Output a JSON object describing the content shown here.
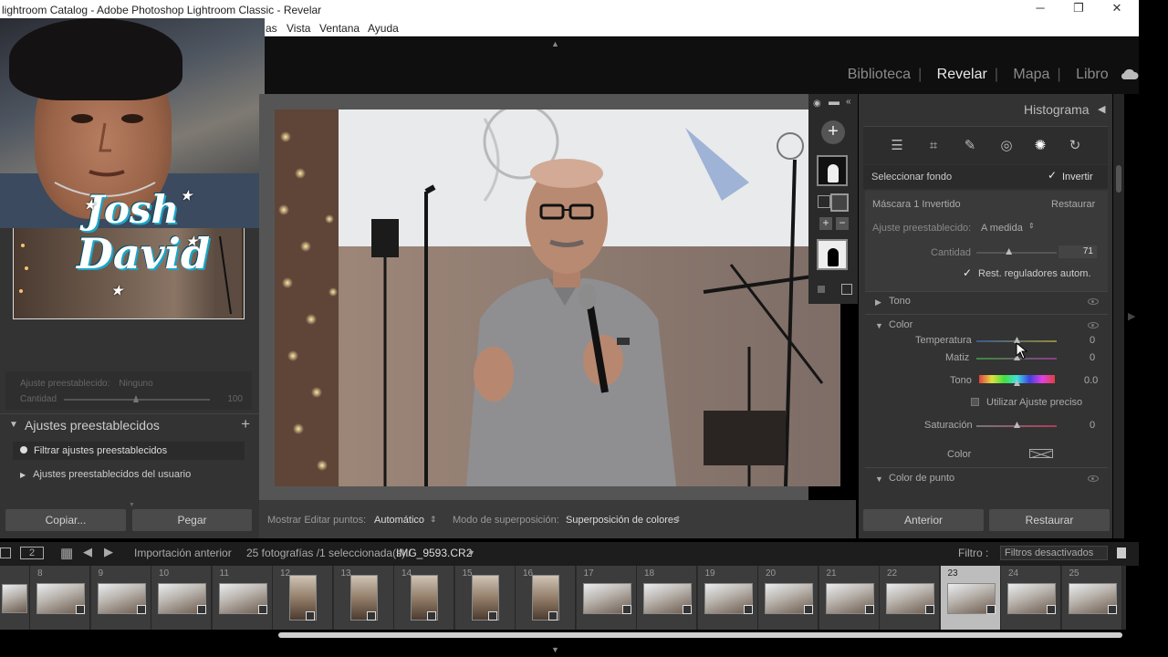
{
  "window": {
    "title": "lightroom Catalog - Adobe Photoshop Lightroom Classic - Revelar",
    "minimize": "─",
    "restore": "❐",
    "close": "✕"
  },
  "menu": [
    "as",
    "Vista",
    "Ventana",
    "Ayuda"
  ],
  "modules": [
    "Biblioteca",
    "Revelar",
    "Mapa",
    "Libro"
  ],
  "modules_more": "»",
  "overlay": {
    "logo_line1": "Josh",
    "logo_line2": "David"
  },
  "left": {
    "preset_label": "Ajuste preestablecido:",
    "preset_value": "Ninguno",
    "amount_label": "Cantidad",
    "amount_value": "100",
    "presets_title": "Ajustes preestablecidos",
    "add_symbol": "+",
    "filter_placeholder": "Filtrar ajustes preestablecidos",
    "user_presets": "Ajustes preestablecidos del usuario",
    "copy_button": "Copiar...",
    "paste_button": "Pegar"
  },
  "toolbar": {
    "show_edit_label": "Mostrar Editar puntos:",
    "show_edit_value": "Automático",
    "overlay_mode_label": "Modo de superposición:",
    "overlay_mode_value": "Superposición de colores"
  },
  "right": {
    "histogram": "Histograma",
    "select_bg": "Seleccionar fondo",
    "invert": "Invertir",
    "mask_name": "Máscara 1 Invertido",
    "restore": "Restaurar",
    "preset_label": "Ajuste preestablecido:",
    "preset_value": "A medida",
    "amount_label": "Cantidad",
    "amount_value": "71",
    "amount": 0.4,
    "auto_reset": "Rest. reguladores autom.",
    "tone_section": "Tono",
    "color_section": "Color",
    "temperature_label": "Temperatura",
    "temperature_value": "0",
    "tint_label": "Matiz",
    "tint_value": "0",
    "hue_label": "Tono",
    "hue_value": "0.0",
    "fine_adjust": "Utilizar Ajuste preciso",
    "saturation_label": "Saturación",
    "saturation_value": "0",
    "color_label": "Color",
    "point_color_section": "Color de punto",
    "previous_button": "Anterior",
    "reset_button": "Restaurar"
  },
  "filmbar": {
    "page": "2",
    "source": "Importación anterior",
    "count": "25 fotografías /1 seleccionada(s) /",
    "filename": "IMG_9593.CR2",
    "filter_label": "Filtro :",
    "filter_value": "Filtros desactivados"
  },
  "filmstrip": [
    "8",
    "9",
    "10",
    "11",
    "12",
    "13",
    "14",
    "15",
    "16",
    "17",
    "18",
    "19",
    "20",
    "21",
    "22",
    "23",
    "24",
    "25"
  ],
  "filmstrip_selected": "23",
  "colors": {
    "panel_bg": "#333333",
    "accent": "#e8e8e8",
    "selected_cell": "#bdbdbd"
  }
}
